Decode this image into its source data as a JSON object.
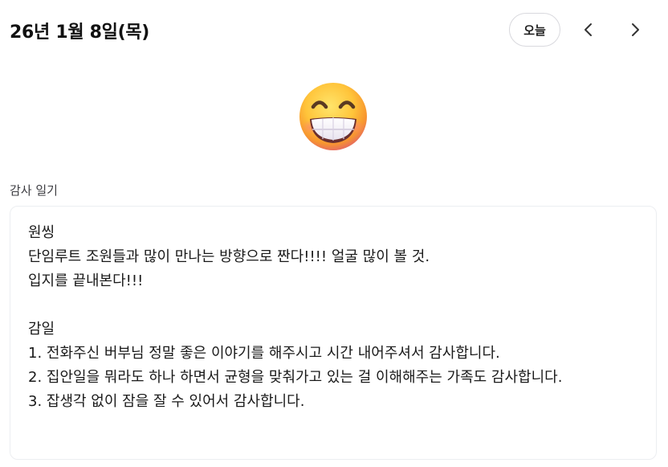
{
  "header": {
    "date_title": "26년 1월 8일(목)",
    "today_label": "오늘"
  },
  "mood": {
    "icon": "grinning-face-icon"
  },
  "section": {
    "label": "감사 일기"
  },
  "entry": {
    "lines": [
      "원씽",
      "단임루트 조원들과 많이 만나는 방향으로 짠다!!!! 얼굴 많이 볼 것.",
      "입지를 끝내본다!!!",
      "",
      "감일",
      "1. 전화주신 버부님 정말 좋은 이야기를 해주시고 시간 내어주셔서 감사합니다.",
      "2. 집안일을 뭐라도 하나 하면서 균형을 맞춰가고 있는 걸 이해해주는 가족도 감사합니다.",
      "3. 잡생각 없이 잠을 잘 수 있어서 감사합니다."
    ]
  }
}
